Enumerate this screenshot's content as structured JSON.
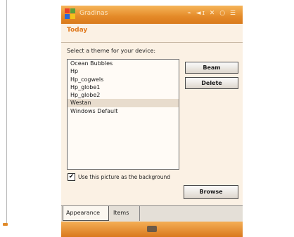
{
  "window": {
    "app_title": "Gradinas",
    "status": "⌁ ◄ɪ ✕ ○ ☰"
  },
  "page": {
    "heading": "Today",
    "instruction": "Select a theme for your device:"
  },
  "themes": {
    "items": [
      "Ocean Bubbles",
      "Hp",
      "Hp_cogwels",
      "Hp_globe1",
      "Hp_globe2",
      "Westan",
      "Windows Default"
    ],
    "selected_index": 5
  },
  "buttons": {
    "beam": "Beam",
    "delete": "Delete",
    "browse": "Browse"
  },
  "background_option": {
    "checked": true,
    "check_mark": "✔",
    "label": "Use this picture as the background"
  },
  "tabs": [
    {
      "label": "Appearance"
    },
    {
      "label": "Items"
    }
  ],
  "colors": {
    "accent": "#e48a28",
    "heading": "#e07a1e"
  }
}
